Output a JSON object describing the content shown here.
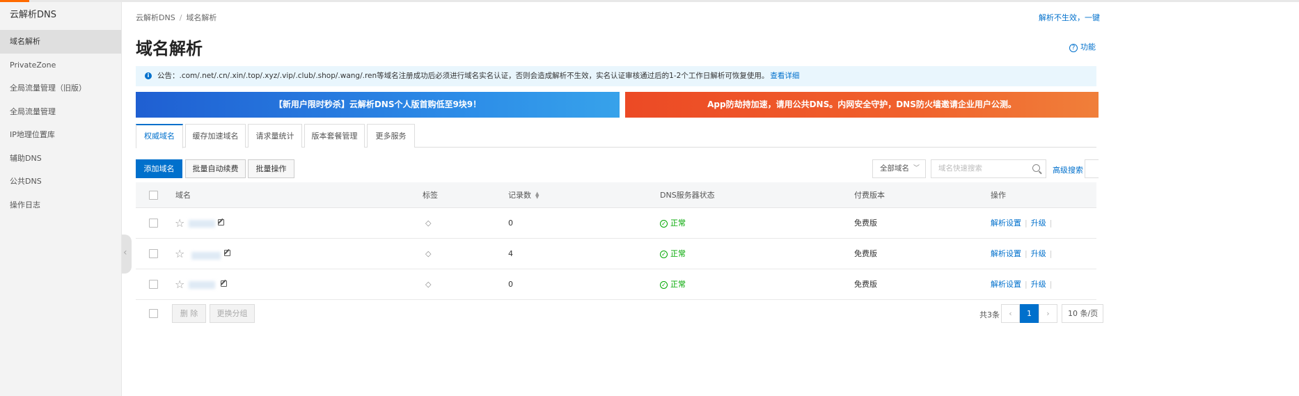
{
  "colors": {
    "accent": "#0070cc",
    "brand": "#ff6a00",
    "success": "#00a700"
  },
  "sidebar": {
    "title": "云解析DNS",
    "items": [
      {
        "label": "域名解析"
      },
      {
        "label": "PrivateZone"
      },
      {
        "label": "全局流量管理（旧版）"
      },
      {
        "label": "全局流量管理"
      },
      {
        "label": "IP地理位置库"
      },
      {
        "label": "辅助DNS"
      },
      {
        "label": "公共DNS"
      },
      {
        "label": "操作日志"
      }
    ]
  },
  "breadcrumb": {
    "root": "云解析DNS",
    "separator": "/",
    "current": "域名解析"
  },
  "header": {
    "top_link": "解析不生效，一键",
    "title": "域名解析",
    "help_link": "功能",
    "help_icon": "question-icon"
  },
  "notice": {
    "text": "公告：.com/.net/.cn/.xin/.top/.xyz/.vip/.club/.shop/.wang/.ren等域名注册成功后必须进行域名实名认证，否则会造成解析不生效，实名认证审核通过后的1-2个工作日解析可恢复使用。",
    "link": "查看详细"
  },
  "banners": {
    "left": "【新用户限时秒杀】云解析DNS个人版首购低至9块9！",
    "right": "App防劫持加速，请用公共DNS。内网安全守护，DNS防火墙邀请企业用户公测。"
  },
  "tabs": [
    {
      "label": "权威域名"
    },
    {
      "label": "缓存加速域名"
    },
    {
      "label": "请求量统计"
    },
    {
      "label": "版本套餐管理"
    },
    {
      "label": "更多服务"
    }
  ],
  "toolbar": {
    "add_domain": "添加域名",
    "batch_renew": "批量自动续费",
    "batch_ops": "批量操作",
    "filter_value": "全部域名",
    "search_placeholder": "域名快速搜索",
    "advanced_search": "高级搜索"
  },
  "table": {
    "headers": {
      "domain": "域名",
      "tag": "标签",
      "records": "记录数",
      "dns_status": "DNS服务器状态",
      "edition": "付费版本",
      "actions": "操作"
    },
    "rows": [
      {
        "records": "0",
        "status": "正常",
        "edition": "免费版",
        "op1": "解析设置",
        "op2": "升级"
      },
      {
        "records": "4",
        "status": "正常",
        "edition": "免费版",
        "op1": "解析设置",
        "op2": "升级"
      },
      {
        "records": "0",
        "status": "正常",
        "edition": "免费版",
        "op1": "解析设置",
        "op2": "升级"
      }
    ]
  },
  "footer": {
    "delete": "删 除",
    "change_group": "更换分组",
    "total": "共3条",
    "current_page": "1",
    "page_size": "10 条/页"
  }
}
